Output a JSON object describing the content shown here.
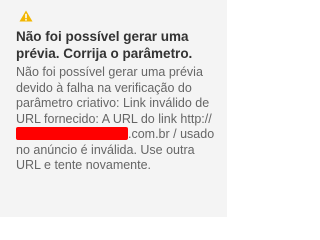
{
  "alert": {
    "icon": "warning-icon",
    "icon_color": "#f2b600",
    "title": "Não foi possível gerar uma prévia. Corrija o parâmetro.",
    "message_before": "Não foi possível gerar uma prévia devido à falha na verificação do parâmetro criativo: Link inválido de URL fornecido: A URL do link http://",
    "redaction_color": "#ff0000",
    "message_after": ".com.br / usado no anúncio é inválida. Use outra URL e tente novamente."
  }
}
